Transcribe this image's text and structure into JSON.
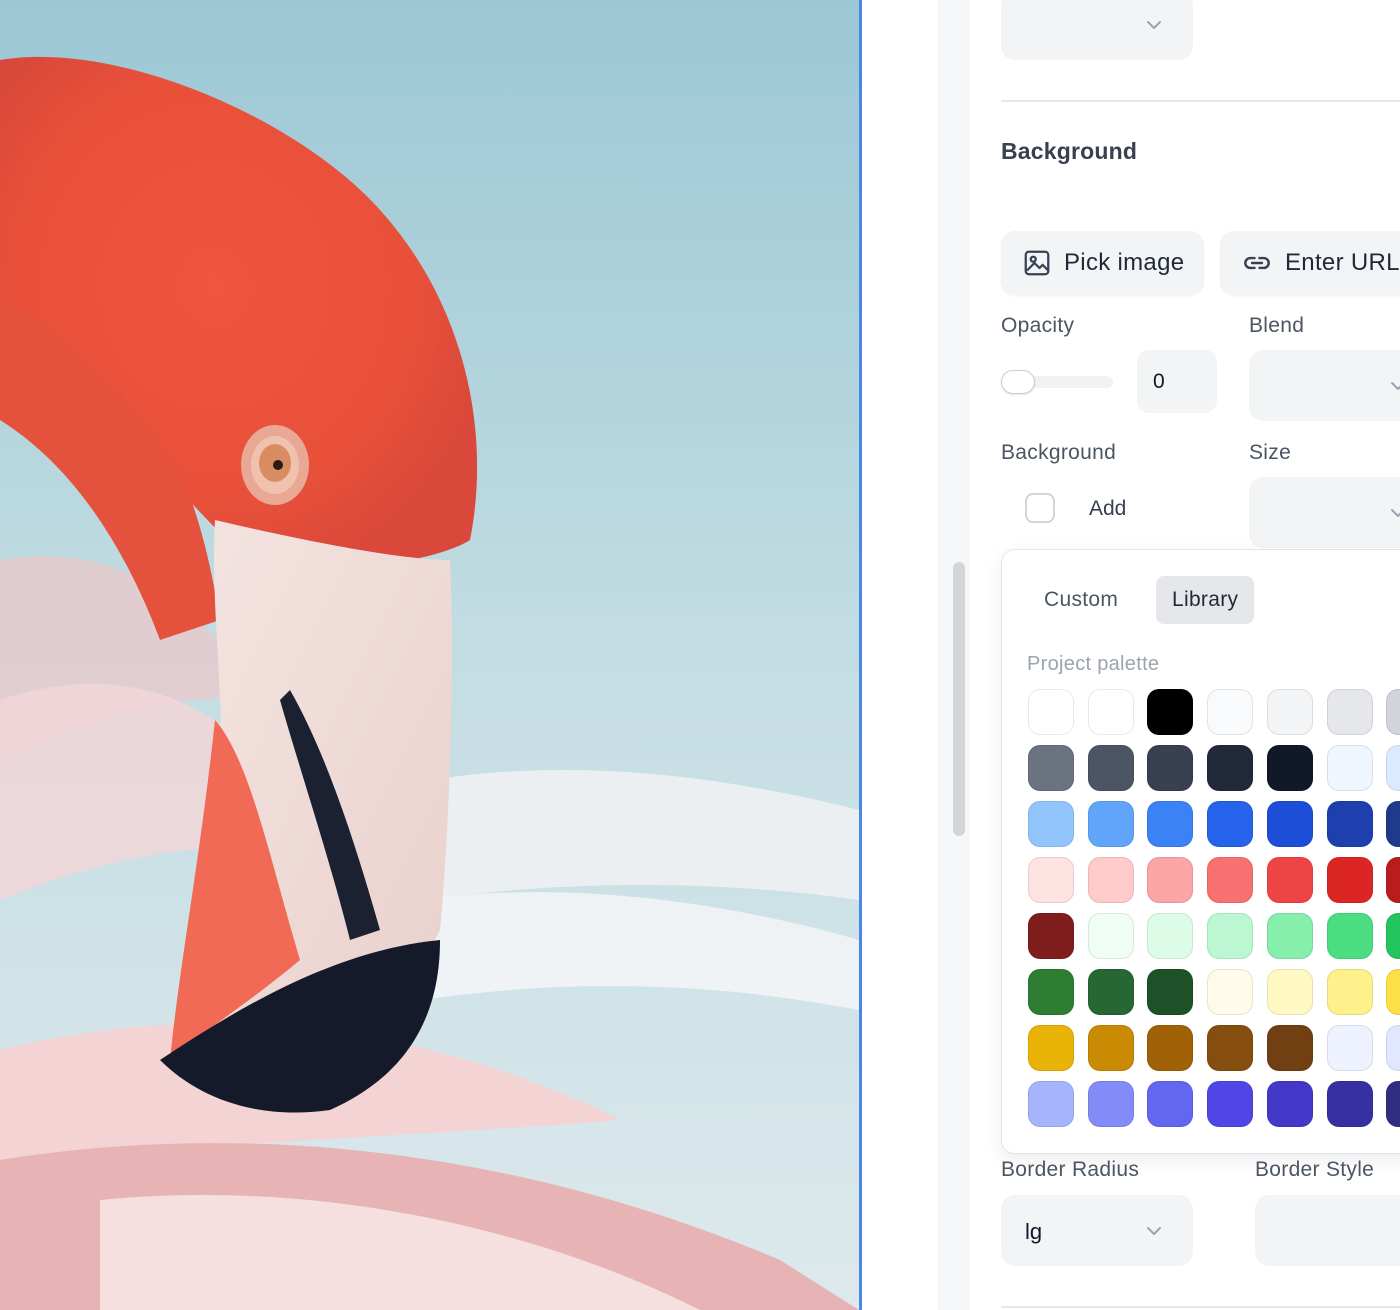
{
  "canvas": {
    "description_icon": "flamingo-photo"
  },
  "inspector": {
    "top_select": {
      "value": ""
    },
    "background_section": {
      "title": "Background",
      "pick_image_label": "Pick image",
      "enter_url_label": "Enter URL",
      "opacity_label": "Opacity",
      "opacity_value": "0",
      "opacity_level": 0,
      "blend_label": "Blend",
      "blend_value": "",
      "background_label": "Background",
      "add_label": "Add",
      "size_label": "Size",
      "size_value": ""
    },
    "border": {
      "radius_label": "Border Radius",
      "radius_value": "lg",
      "style_label": "Border Style",
      "style_value": ""
    }
  },
  "color_picker": {
    "tabs": [
      {
        "label": "Custom",
        "active": false
      },
      {
        "label": "Library",
        "active": true
      }
    ],
    "palette_title": "Project palette",
    "swatches": [
      [
        "#ffffff",
        "#ffffff",
        "#000000",
        "#f9fafb",
        "#f3f4f6",
        "#e5e7eb",
        "#d1d5db"
      ],
      [
        "#6b7280",
        "#4b5563",
        "#374151",
        "#1f2937",
        "#111827",
        "#eff6ff",
        "#dbeafe"
      ],
      [
        "#93c5fd",
        "#60a5fa",
        "#3b82f6",
        "#2563eb",
        "#1d4ed8",
        "#1e40af",
        "#1e3a8a"
      ],
      [
        "#fee2e2",
        "#fecaca",
        "#fca5a5",
        "#f87171",
        "#ef4444",
        "#dc2626",
        "#b91c1c"
      ],
      [
        "#7f1d1d",
        "#f0fdf4",
        "#dcfce7",
        "#bbf7d0",
        "#86efac",
        "#4ade80",
        "#22c55e"
      ],
      [
        "#2e7d32",
        "#276733",
        "#1e5128",
        "#fefce8",
        "#fef9c3",
        "#fef08a",
        "#fde047"
      ],
      [
        "#eab308",
        "#ca8a04",
        "#a16207",
        "#854d0e",
        "#713f12",
        "#eef2ff",
        "#e0e7ff"
      ],
      [
        "#a5b4fc",
        "#818cf8",
        "#6366f1",
        "#4f46e5",
        "#4338ca",
        "#3730a3",
        "#312e81"
      ]
    ]
  }
}
